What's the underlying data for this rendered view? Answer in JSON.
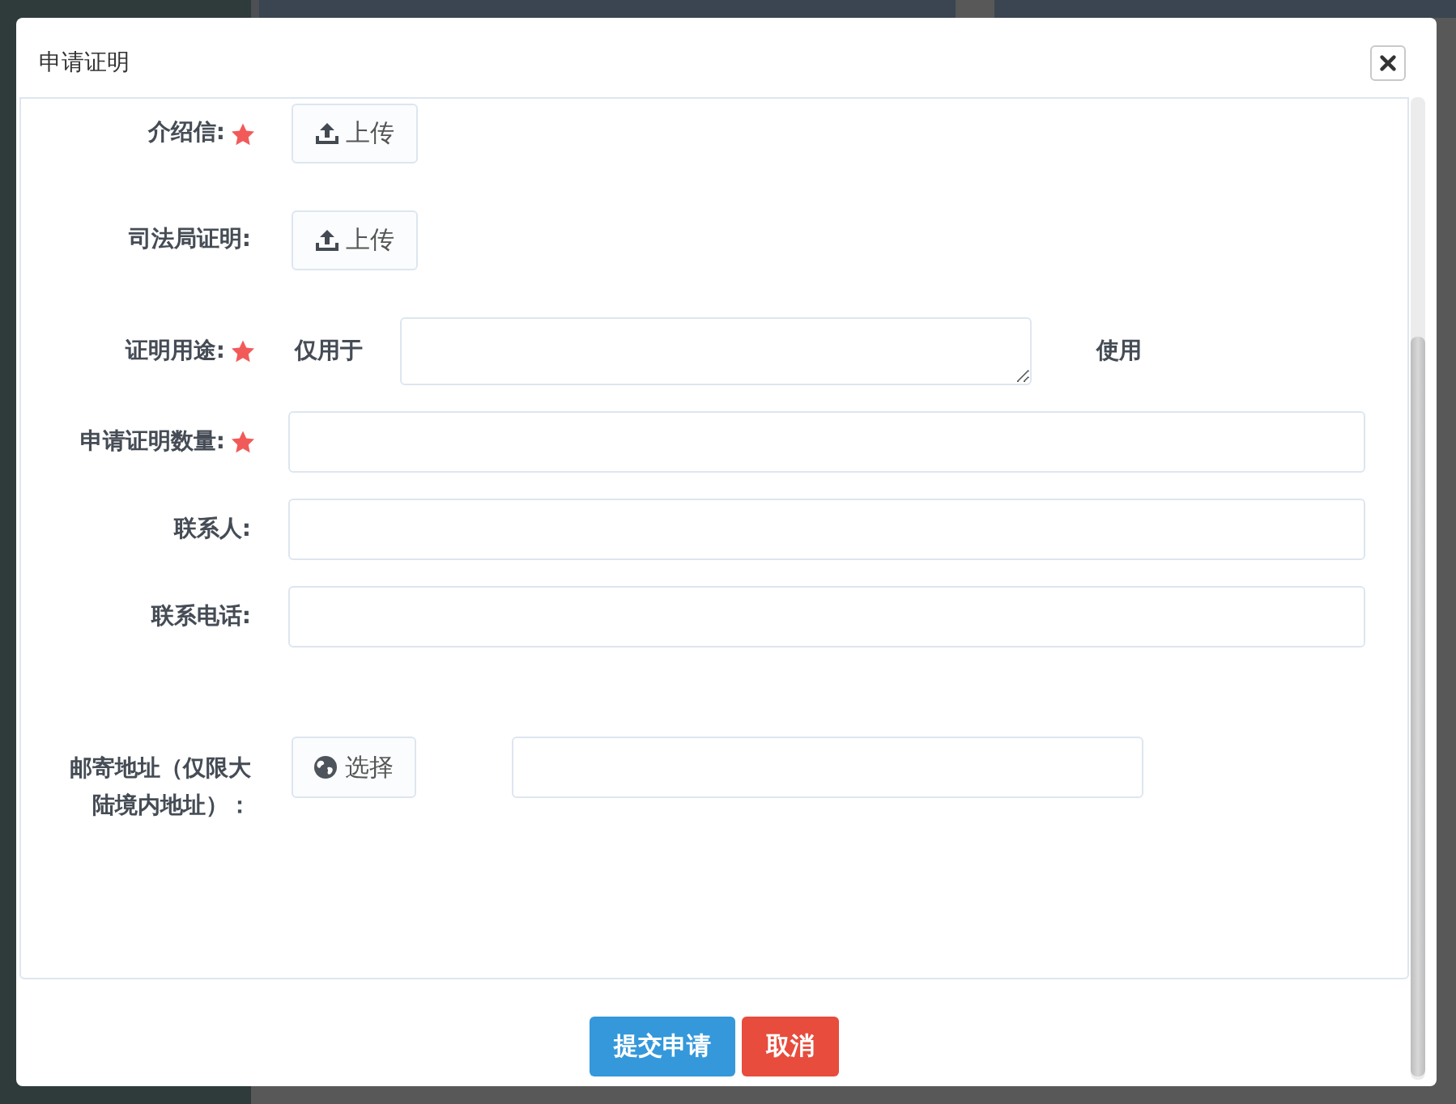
{
  "dialog": {
    "title": "申请证明"
  },
  "form": {
    "fields": [
      {
        "kind": "upload",
        "label": "介绍信:",
        "required": true,
        "button": "上传"
      },
      {
        "kind": "upload",
        "label": "司法局证明:",
        "required": false,
        "button": "上传"
      },
      {
        "kind": "purpose",
        "label": "证明用途:",
        "required": true,
        "prefix": "仅用于",
        "suffix": "使用"
      },
      {
        "kind": "text",
        "label": "申请证明数量:",
        "required": true
      },
      {
        "kind": "text",
        "label": "联系人:",
        "required": false
      },
      {
        "kind": "text",
        "label": "联系电话:",
        "required": false
      },
      {
        "kind": "address",
        "label": "邮寄地址（仅限大陆境内地址）：",
        "required": false,
        "button": "选择"
      }
    ]
  },
  "footer": {
    "buttons": [
      {
        "kind": "primary",
        "label": "提交申请"
      },
      {
        "kind": "danger",
        "label": "取消"
      }
    ]
  }
}
